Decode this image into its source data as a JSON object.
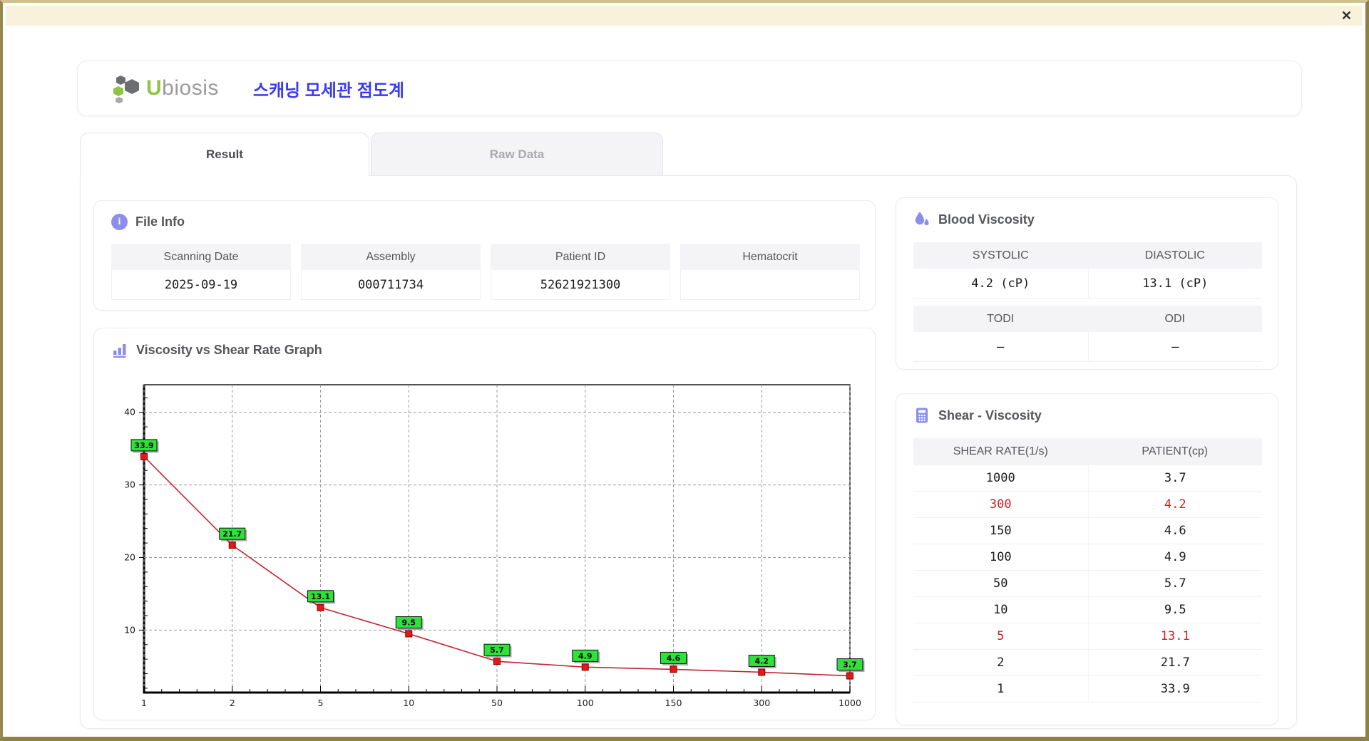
{
  "window": {
    "close_icon": "✕"
  },
  "header": {
    "brand_first": "U",
    "brand_rest": "biosis",
    "app_title": "스캐닝 모세관 점도계"
  },
  "tabs": {
    "result": "Result",
    "raw_data": "Raw Data"
  },
  "file_info": {
    "title": "File Info",
    "fields": [
      {
        "label": "Scanning Date",
        "value": "2025-09-19"
      },
      {
        "label": "Assembly",
        "value": "000711734"
      },
      {
        "label": "Patient ID",
        "value": "52621921300"
      },
      {
        "label": "Hematocrit",
        "value": ""
      }
    ]
  },
  "blood_viscosity": {
    "title": "Blood Viscosity",
    "groups": [
      [
        {
          "label": "SYSTOLIC",
          "value": "4.2 (cP)"
        },
        {
          "label": "DIASTOLIC",
          "value": "13.1 (cP)"
        }
      ],
      [
        {
          "label": "TODI",
          "value": "–"
        },
        {
          "label": "ODI",
          "value": "–"
        }
      ]
    ]
  },
  "graph": {
    "title": "Viscosity vs Shear Rate Graph"
  },
  "chart_data": {
    "type": "line",
    "title": "Viscosity vs Shear Rate Graph",
    "x_categories": [
      "1",
      "2",
      "5",
      "10",
      "50",
      "100",
      "150",
      "300",
      "1000"
    ],
    "series": [
      {
        "name": "PATIENT(cp)",
        "values": [
          33.9,
          21.7,
          13.1,
          9.5,
          5.7,
          4.9,
          4.6,
          4.2,
          3.7
        ]
      }
    ],
    "point_labels": [
      "33.9",
      "21.7",
      "13.1",
      "9.5",
      "5.7",
      "4.9",
      "4.6",
      "4.2",
      "3.7"
    ],
    "xlabel": "",
    "ylabel": "",
    "yticks": [
      10,
      20,
      30,
      40
    ],
    "ylim": [
      1.4,
      43.8
    ],
    "x_axis": "categorical-equidistant",
    "grid": "dashed",
    "legend": "none",
    "line_color": "#c32530",
    "marker": "square",
    "marker_color": "#e81717",
    "marker_border": "#7d0000",
    "point_label_bg": "#2de239",
    "grid_color": "#9a9a9a"
  },
  "shear_viscosity": {
    "title": "Shear - Viscosity",
    "columns": [
      "SHEAR RATE(1/s)",
      "PATIENT(cp)"
    ],
    "rows": [
      {
        "shear": "1000",
        "patient": "3.7",
        "highlight": false
      },
      {
        "shear": "300",
        "patient": "4.2",
        "highlight": true
      },
      {
        "shear": "150",
        "patient": "4.6",
        "highlight": false
      },
      {
        "shear": "100",
        "patient": "4.9",
        "highlight": false
      },
      {
        "shear": "50",
        "patient": "5.7",
        "highlight": false
      },
      {
        "shear": "10",
        "patient": "9.5",
        "highlight": false
      },
      {
        "shear": "5",
        "patient": "13.1",
        "highlight": true
      },
      {
        "shear": "2",
        "patient": "21.7",
        "highlight": false
      },
      {
        "shear": "1",
        "patient": "33.9",
        "highlight": false
      }
    ],
    "highlight_color": "#cd2026"
  }
}
